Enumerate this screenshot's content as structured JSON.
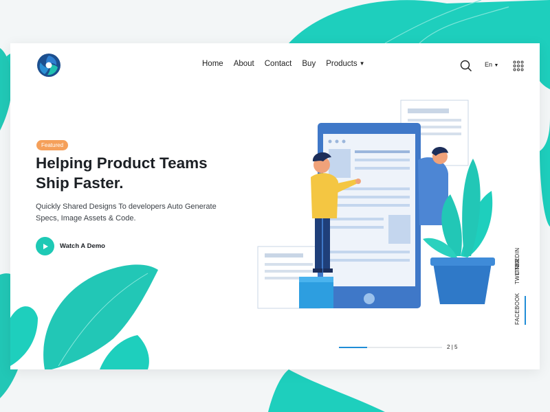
{
  "nav": {
    "items": [
      "Home",
      "About",
      "Contact",
      "Buy"
    ],
    "products_label": "Products"
  },
  "lang": {
    "label": "En"
  },
  "hero": {
    "badge": "Featured",
    "title_line1": "Helping Product Teams",
    "title_line2": "Ship Faster.",
    "subtitle_line1": "Quickly Shared Designs To developers Auto Generate",
    "subtitle_line2": "Specs, Image Assets & Code.",
    "cta": "Watch A Demo"
  },
  "pager": {
    "current": "2",
    "total": "5",
    "separator": "|",
    "progress": 0.27
  },
  "social": [
    "LINKEDIN",
    "TWITTER",
    "FACEBOOK"
  ],
  "colors": {
    "accent": "#1ec9b5",
    "blue": "#1f8cd6",
    "badge": "#f5a05a",
    "phone": "#3f78c8",
    "leaf": "#22c7b6"
  },
  "icons": [
    "logo-icon",
    "search-icon",
    "chevron-down-icon",
    "grid-menu-icon",
    "play-icon"
  ]
}
